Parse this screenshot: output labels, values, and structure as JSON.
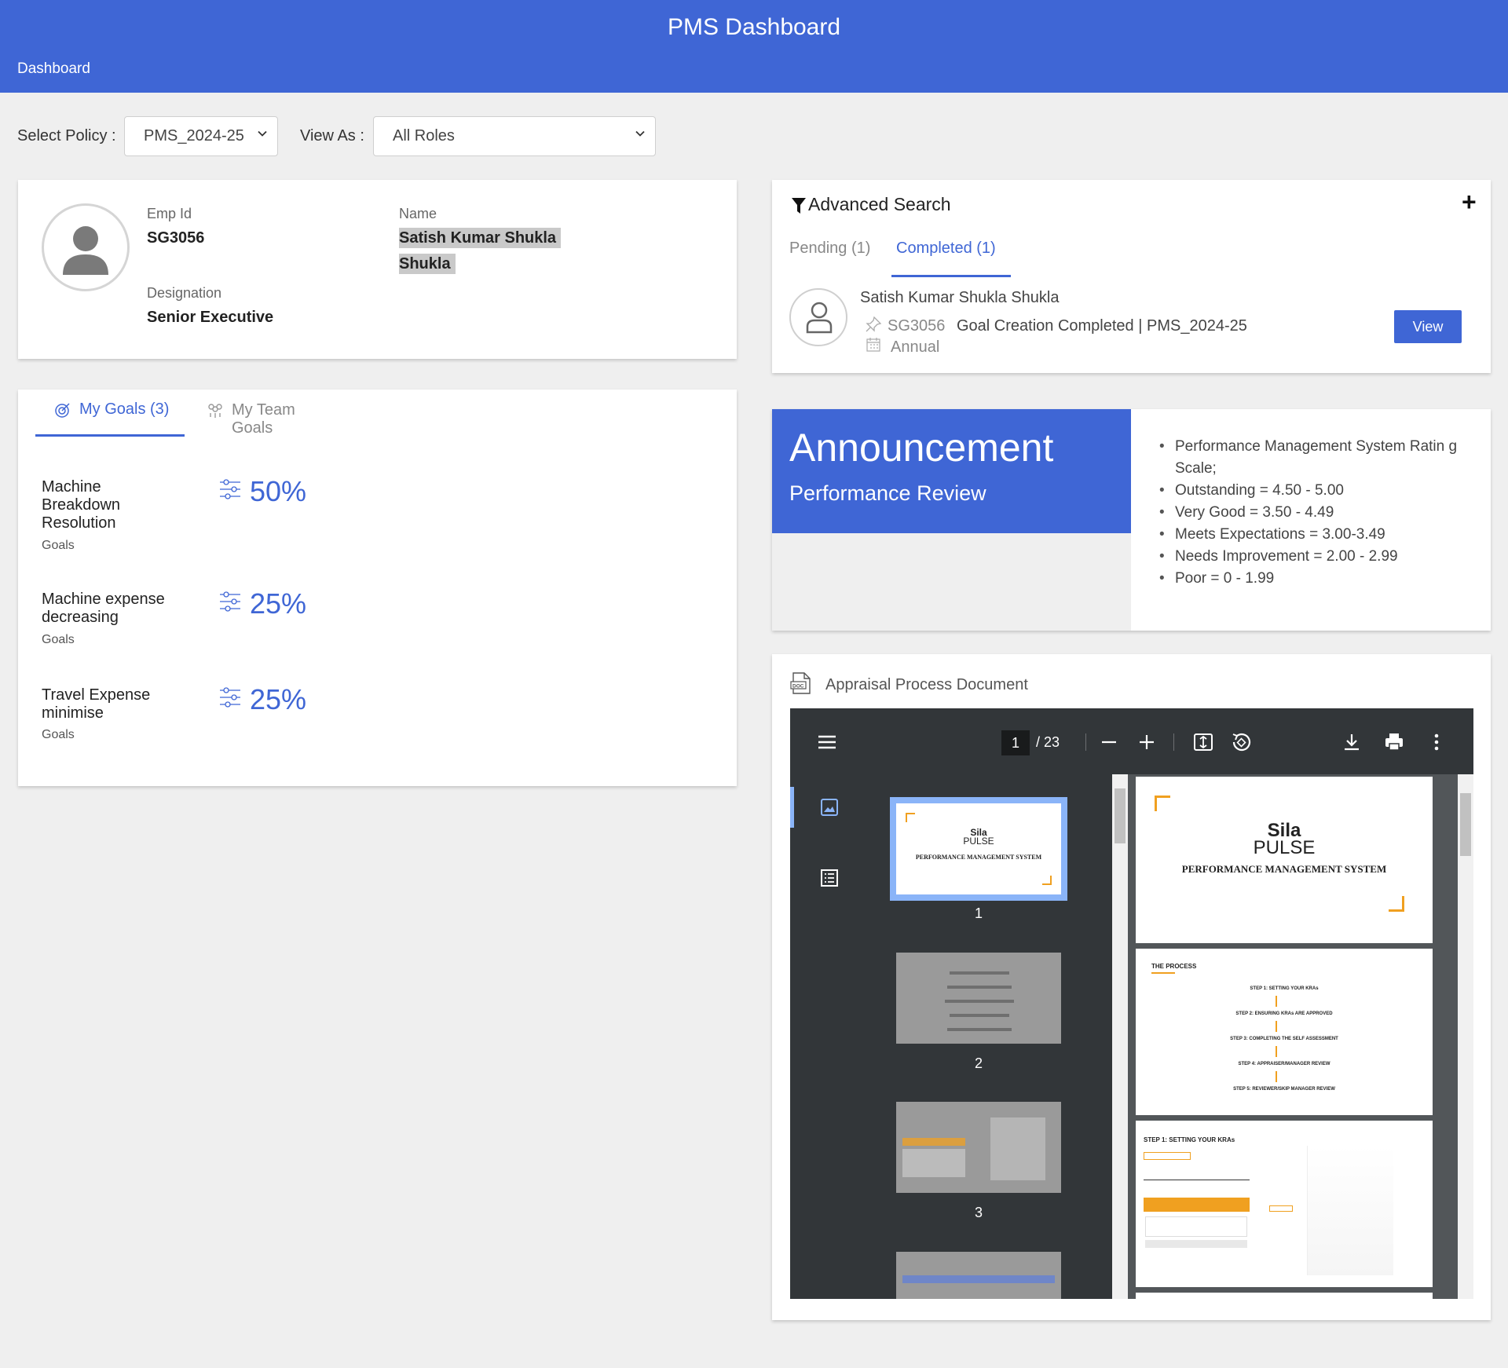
{
  "header": {
    "title": "PMS Dashboard",
    "breadcrumb": "Dashboard"
  },
  "filters": {
    "policy_label": "Select Policy :",
    "policy_value": "PMS_2024-25",
    "view_as_label": "View As :",
    "view_as_value": "All Roles"
  },
  "profile": {
    "emp_id_label": "Emp Id",
    "emp_id": "SG3056",
    "name_label": "Name",
    "name_line1": "Satish Kumar Shukla",
    "name_line2": "Shukla",
    "designation_label": "Designation",
    "designation": "Senior Executive"
  },
  "goals": {
    "tabs": [
      {
        "label": "My Goals (3)",
        "active": true,
        "icon": "target-icon"
      },
      {
        "label": "My Team Goals",
        "active": false,
        "icon": "team-icon"
      }
    ],
    "items": [
      {
        "title_lines": [
          "Machine",
          "Breakdown",
          "Resolution"
        ],
        "sub": "Goals",
        "percent": "50%"
      },
      {
        "title_lines": [
          "Machine expense",
          "decreasing"
        ],
        "sub": "Goals",
        "percent": "25%"
      },
      {
        "title_lines": [
          "Travel Expense",
          "minimise"
        ],
        "sub": "Goals",
        "percent": "25%"
      }
    ]
  },
  "advanced_search": {
    "title": "Advanced Search",
    "add_symbol": "+",
    "tabs": [
      {
        "label": "Pending (1)",
        "active": false
      },
      {
        "label": "Completed (1)",
        "active": true
      }
    ],
    "result": {
      "name": "Satish Kumar Shukla Shukla",
      "emp_id": "SG3056",
      "status": "Goal Creation Completed | PMS_2024-25",
      "cycle": "Annual",
      "action": "View"
    }
  },
  "announcement": {
    "title": "Announcement",
    "subtitle": "Performance Review",
    "items": [
      "Performance Management System Ratin g Scale;",
      "Outstanding = 4.50 - 5.00",
      "Very Good = 3.50 - 4.49",
      "Meets Expectations = 3.00-3.49",
      "Needs Improvement = 2.00 - 2.99",
      "Poor = 0 - 1.99"
    ]
  },
  "document": {
    "title": "Appraisal Process Document",
    "viewer": {
      "current_page": "1",
      "total_pages": "/ 23",
      "thumbnails": [
        "1",
        "2",
        "3"
      ],
      "page1_brand_top": "Sila",
      "page1_brand_bottom": "PULSE",
      "page1_heading": "PERFORMANCE MANAGEMENT SYSTEM",
      "page2_heading": "THE PROCESS",
      "page2_steps": [
        "STEP 1: SETTING YOUR KRAs",
        "STEP 2: ENSURING KRAs ARE APPROVED",
        "STEP 3: COMPLETING THE SELF ASSESSMENT",
        "STEP 4: APPRAISER/MANAGER REVIEW",
        "STEP 5: REVIEWER/SKIP MANAGER REVIEW"
      ],
      "page3_heading": "STEP 1: SETTING YOUR KRAs"
    }
  },
  "colors": {
    "primary": "#3f66d5",
    "background": "#efefef",
    "viewer_dark": "#323639",
    "accent_orange": "#f0a020"
  }
}
